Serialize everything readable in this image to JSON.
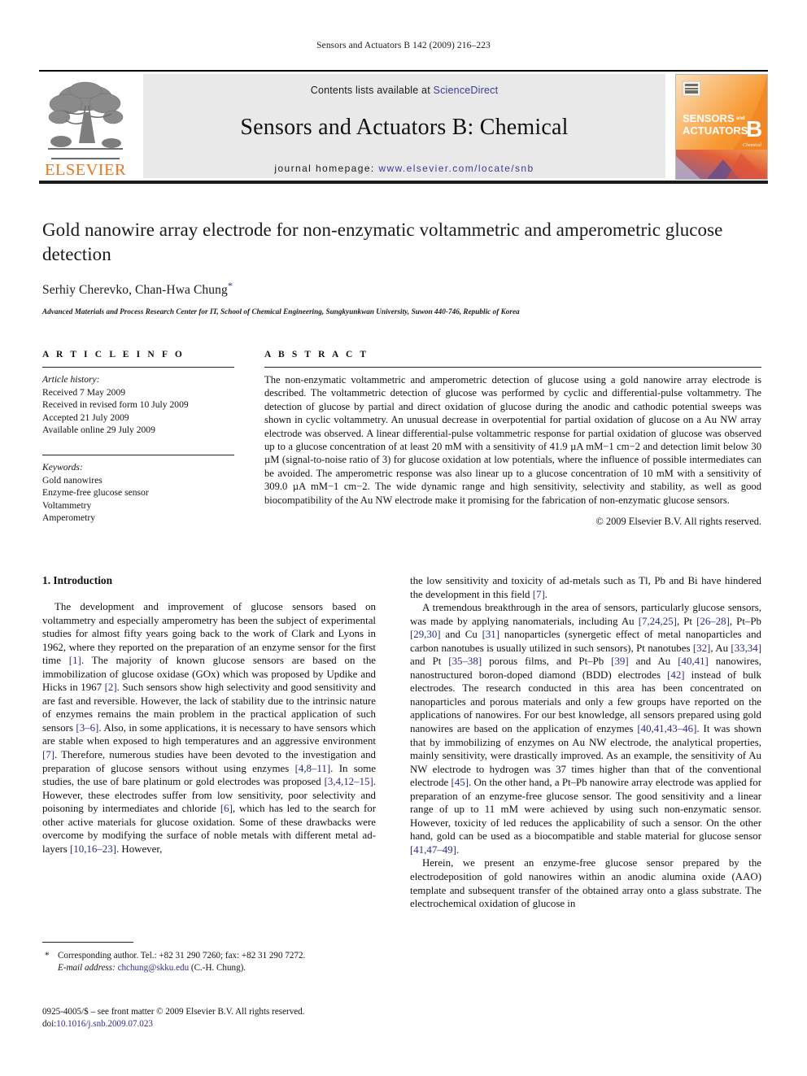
{
  "running_head": "Sensors and Actuators B 142 (2009) 216–223",
  "masthead": {
    "contents_prefix": "Contents lists available at ",
    "sciencedirect": "ScienceDirect",
    "journal_title": "Sensors and Actuators B: Chemical",
    "homepage_prefix": "journal homepage:",
    "homepage_url": "www.elsevier.com/locate/snb",
    "publisher": "ELSEVIER",
    "cover_title_line1": "SENSORS",
    "cover_title_line1_small": "and",
    "cover_title_line2": "ACTUATORS",
    "cover_letter": "B",
    "cover_letter_sub": "Chemical",
    "accent_orange": "#e87722",
    "link_blue": "#3a3a9c",
    "banner_gray": "#e9e9e9"
  },
  "title_block": {
    "title": "Gold nanowire array electrode for non-enzymatic voltammetric and amperometric glucose detection",
    "authors": "Serhiy Cherevko, Chan-Hwa Chung",
    "corresponding_marker": "*",
    "affiliation": "Advanced Materials and Process Research Center for IT, School of Chemical Engineering, Sungkyunkwan University, Suwon 440-746, Republic of Korea"
  },
  "article_info": {
    "heading": "A R T I C L E   I N F O",
    "history_label": "Article history:",
    "history": [
      "Received 7 May 2009",
      "Received in revised form 10 July 2009",
      "Accepted 21 July 2009",
      "Available online 29 July 2009"
    ],
    "keywords_label": "Keywords:",
    "keywords": [
      "Gold nanowires",
      "Enzyme-free glucose sensor",
      "Voltammetry",
      "Amperometry"
    ]
  },
  "abstract": {
    "heading": "A B S T R A C T",
    "text": "The non-enzymatic voltammetric and amperometric detection of glucose using a gold nanowire array electrode is described. The voltammetric detection of glucose was performed by cyclic and differential-pulse voltammetry. The detection of glucose by partial and direct oxidation of glucose during the anodic and cathodic potential sweeps was shown in cyclic voltammetry. An unusual decrease in overpotential for partial oxidation of glucose on a Au NW array electrode was observed. A linear differential-pulse voltammetric response for partial oxidation of glucose was observed up to a glucose concentration of at least 20 mM with a sensitivity of 41.9 µA mM−1 cm−2 and detection limit below 30 µM (signal-to-noise ratio of 3) for glucose oxidation at low potentials, where the influence of possible intermediates can be avoided. The amperometric response was also linear up to a glucose concentration of 10 mM with a sensitivity of 309.0 µA mM−1 cm−2. The wide dynamic range and high sensitivity, selectivity and stability, as well as good biocompatibility of the Au NW electrode make it promising for the fabrication of non-enzymatic glucose sensors.",
    "copyright": "© 2009 Elsevier B.V. All rights reserved."
  },
  "body": {
    "section_number_title": "1.  Introduction",
    "left_paragraph_1": "The development and improvement of glucose sensors based on voltammetry and especially amperometry has been the subject of experimental studies for almost fifty years going back to the work of Clark and Lyons in 1962, where they reported on the preparation of an enzyme sensor for the first time [1]. The majority of known glucose sensors are based on the immobilization of glucose oxidase (GOx) which was proposed by Updike and Hicks in 1967 [2]. Such sensors show high selectivity and good sensitivity and are fast and reversible. However, the lack of stability due to the intrinsic nature of enzymes remains the main problem in the practical application of such sensors [3–6]. Also, in some applications, it is necessary to have sensors which are stable when exposed to high temperatures and an aggressive environment [7]. Therefore, numerous studies have been devoted to the investigation and preparation of glucose sensors without using enzymes [4,8–11]. In some studies, the use of bare platinum or gold electrodes was proposed [3,4,12–15]. However, these electrodes suffer from low sensitivity, poor selectivity and poisoning by intermediates and chloride [6], which has led to the search for other active materials for glucose oxidation. Some of these drawbacks were overcome by modifying the surface of noble metals with different metal ad-layers [10,16–23]. However,",
    "right_paragraph_1_cont": "the low sensitivity and toxicity of ad-metals such as Tl, Pb and Bi have hindered the development in this field [7].",
    "right_paragraph_2": "A tremendous breakthrough in the area of sensors, particularly glucose sensors, was made by applying nanomaterials, including Au [7,24,25], Pt [26–28], Pt–Pb [29,30] and Cu [31] nanoparticles (synergetic effect of metal nanoparticles and carbon nanotubes is usually utilized in such sensors), Pt nanotubes [32], Au [33,34] and Pt [35–38] porous films, and Pt–Pb [39] and Au [40,41] nanowires, nanostructured boron-doped diamond (BDD) electrodes [42] instead of bulk electrodes. The research conducted in this area has been concentrated on nanoparticles and porous materials and only a few groups have reported on the applications of nanowires. For our best knowledge, all sensors prepared using gold nanowires are based on the application of enzymes [40,41,43–46]. It was shown that by immobilizing of enzymes on Au NW electrode, the analytical properties, mainly sensitivity, were drastically improved. As an example, the sensitivity of Au NW electrode to hydrogen was 37 times higher than that of the conventional electrode [45]. On the other hand, a Pt–Pb nanowire array electrode was applied for preparation of an enzyme-free glucose sensor. The good sensitivity and a linear range of up to 11 mM were achieved by using such non-enzymatic sensor. However, toxicity of led reduces the applicability of such a sensor. On the other hand, gold can be used as a biocompatible and stable material for glucose sensor [41,47–49].",
    "right_paragraph_3": "Herein, we present an enzyme-free glucose sensor prepared by the electrodeposition of gold nanowires within an anodic alumina oxide (AAO) template and subsequent transfer of the obtained array onto a glass substrate. The electrochemical oxidation of glucose in"
  },
  "footnotes": {
    "star": "*",
    "corresponding_label": "Corresponding author. Tel.: +82 31 290 7260; fax: +82 31 290 7272.",
    "email_label": "E-mail address:",
    "email": "chchung@skku.edu",
    "email_suffix": "(C.-H. Chung).",
    "issn_line": "0925-4005/$ – see front matter © 2009 Elsevier B.V. All rights reserved.",
    "doi_label": "doi:",
    "doi": "10.1016/j.snb.2009.07.023"
  }
}
